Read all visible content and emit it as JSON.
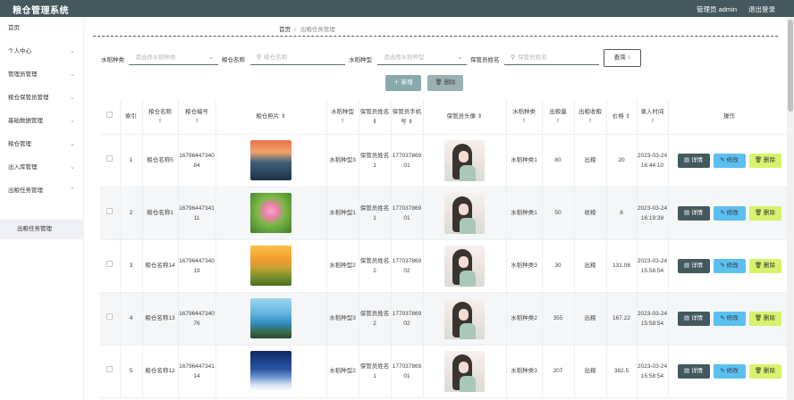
{
  "header": {
    "title": "粮仓管理系统",
    "admin": "管理员 admin",
    "logout": "退出登录"
  },
  "sidebar": {
    "items": [
      {
        "label": "首页"
      },
      {
        "label": "个人中心"
      },
      {
        "label": "管理员管理"
      },
      {
        "label": "粮仓保管员管理"
      },
      {
        "label": "基础数据管理"
      },
      {
        "label": "粮仓管理"
      },
      {
        "label": "出入库管理"
      },
      {
        "label": "出粮任务管理"
      }
    ],
    "sub_item": "出粮任务管理"
  },
  "breadcrumb": {
    "home": "首页",
    "current": "出粮任务管理"
  },
  "filters": {
    "type_label": "水稻种类",
    "type_placeholder": "请选择水稻种类",
    "name_label": "粮仓名称",
    "name_placeholder": "粮仓名称",
    "rice_label": "水稻种型",
    "rice_placeholder": "请选择水稻种型",
    "keeper_label": "保管员姓名",
    "keeper_placeholder": "保管员姓名",
    "query_button": "查询"
  },
  "actions": {
    "add": "新增",
    "delete": "删除"
  },
  "table": {
    "headers": {
      "index": "索引",
      "name": "粮仓名称",
      "code": "粮仓编号",
      "photo": "粮仓照片",
      "rice_type": "水稻种型",
      "keeper": "保管员姓名",
      "phone": "保管员手机号",
      "avatar": "保管员头像",
      "variety": "水稻种类",
      "amount": "出粮量",
      "op_type": "出粮收粮",
      "price": "价格",
      "time": "录入时间",
      "ops": "操作"
    },
    "buttons": {
      "detail": "详情",
      "edit": "修改",
      "delete": "删除"
    },
    "rows": [
      {
        "index": "1",
        "name": "粮仓名称5",
        "code": "1679644734084",
        "rice_type": "水稻种型3",
        "keeper": "保管员姓名1",
        "phone": "17703786901",
        "variety": "水稻种类1",
        "amount": "80",
        "op_type": "出粮",
        "price": "20",
        "time": "2023-03-24 16:44:10"
      },
      {
        "index": "2",
        "name": "粮仓名称1",
        "code": "1679644734111",
        "rice_type": "水稻种型1",
        "keeper": "保管员姓名1",
        "phone": "17703786901",
        "variety": "水稻种类1",
        "amount": "50",
        "op_type": "收粮",
        "price": "8",
        "time": "2023-03-24 16:19:39"
      },
      {
        "index": "3",
        "name": "粮仓名称14",
        "code": "1679644734019",
        "rice_type": "水稻种型2",
        "keeper": "保管员姓名2",
        "phone": "17703786902",
        "variety": "水稻种类3",
        "amount": "30",
        "op_type": "出粮",
        "price": "131.06",
        "time": "2023-03-24 15:58:54"
      },
      {
        "index": "4",
        "name": "粮仓名称13",
        "code": "1679644734076",
        "rice_type": "水稻种型3",
        "keeper": "保管员姓名2",
        "phone": "17703786902",
        "variety": "水稻种类2",
        "amount": "355",
        "op_type": "出粮",
        "price": "167.22",
        "time": "2023-03-24 15:58:54"
      },
      {
        "index": "5",
        "name": "粮仓名称12",
        "code": "1679644734114",
        "rice_type": "水稻种型2",
        "keeper": "保管员姓名1",
        "phone": "17703786901",
        "variety": "水稻种类3",
        "amount": "207",
        "op_type": "出粮",
        "price": "382.5",
        "time": "2023-03-24 15:58:54"
      }
    ]
  }
}
